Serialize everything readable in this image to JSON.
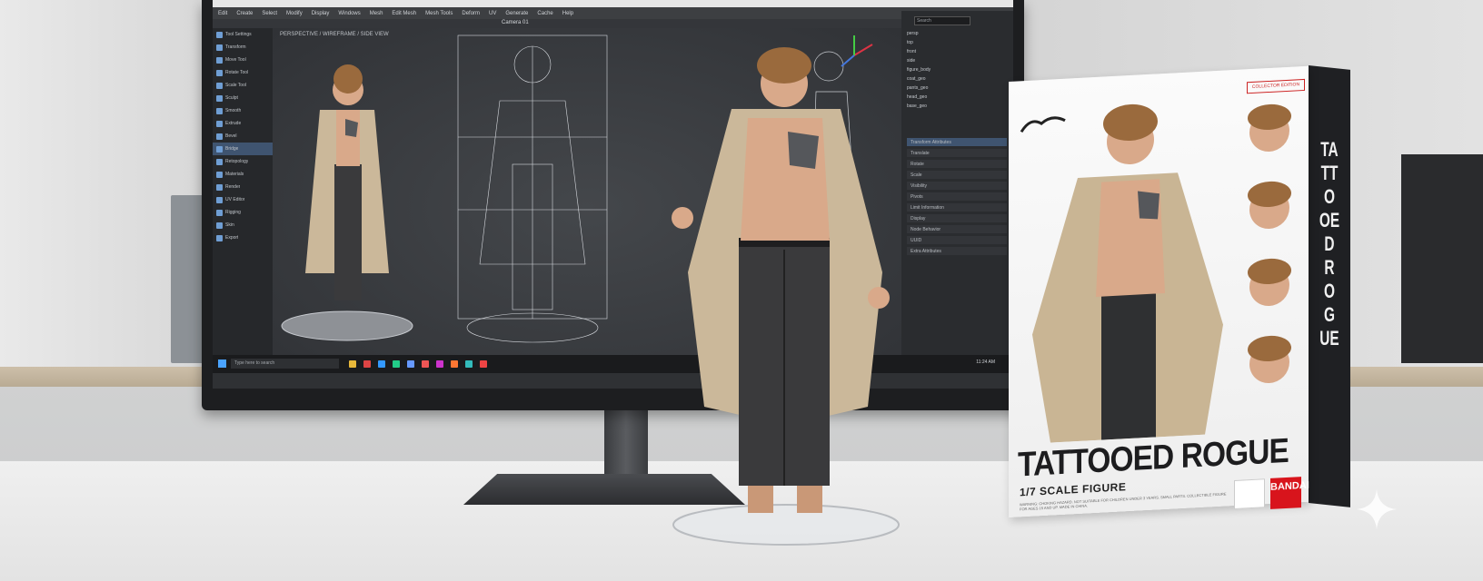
{
  "monitor": {
    "menu_items": [
      "Edit",
      "Create",
      "Select",
      "Modify",
      "Display",
      "Windows",
      "Mesh",
      "Edit Mesh",
      "Mesh Tools",
      "Deform",
      "UV",
      "Generate",
      "Cache",
      "Help"
    ],
    "toolbar_caption": "Camera  01",
    "viewport_label": "PERSPECTIVE / WIREFRAME / SIDE VIEW",
    "left_panel_items": [
      "Tool Settings",
      "Transform",
      "Move Tool",
      "Rotate Tool",
      "Scale Tool",
      "Sculpt",
      "Smooth",
      "Extrude",
      "Bevel",
      "Bridge",
      "Retopology",
      "Materials",
      "Render",
      "UV Editor",
      "Rigging",
      "Skin",
      "Export"
    ],
    "right_panel_search": "Search",
    "outliner_items": [
      "persp",
      "top",
      "front",
      "side",
      "figure_body",
      "coat_geo",
      "pants_geo",
      "head_geo",
      "base_geo"
    ],
    "properties": [
      "Transform Attributes",
      "Translate",
      "Rotate",
      "Scale",
      "Visibility",
      "Pivots",
      "Limit Information",
      "Display",
      "Node Behavior",
      "UUID",
      "Extra Attributes"
    ],
    "taskbar_search": "Type here to search",
    "taskbar_time": "11:24 AM"
  },
  "box": {
    "title": "TATTOOED ROGUE",
    "subtitle": "1/7 SCALE FIGURE",
    "side_title": "TATTOOED ROGUE",
    "badge": "COLLECTOR EDITION",
    "manufacturer": "BANDAI",
    "fine_print": "WARNING: CHOKING HAZARD. NOT SUITABLE FOR CHILDREN UNDER 3 YEARS. SMALL PARTS. COLLECTIBLE FIGURE FOR AGES 15 AND UP. MADE IN CHINA."
  },
  "colors": {
    "wall": "#dcdcdc",
    "desk": "#ececec",
    "screen_bg": "#2f3134",
    "coat": "#cbb89a",
    "pants": "#3a3a3c",
    "skin": "#d9a98a",
    "hair": "#9a6a3d",
    "bandai_red": "#d8141c"
  }
}
